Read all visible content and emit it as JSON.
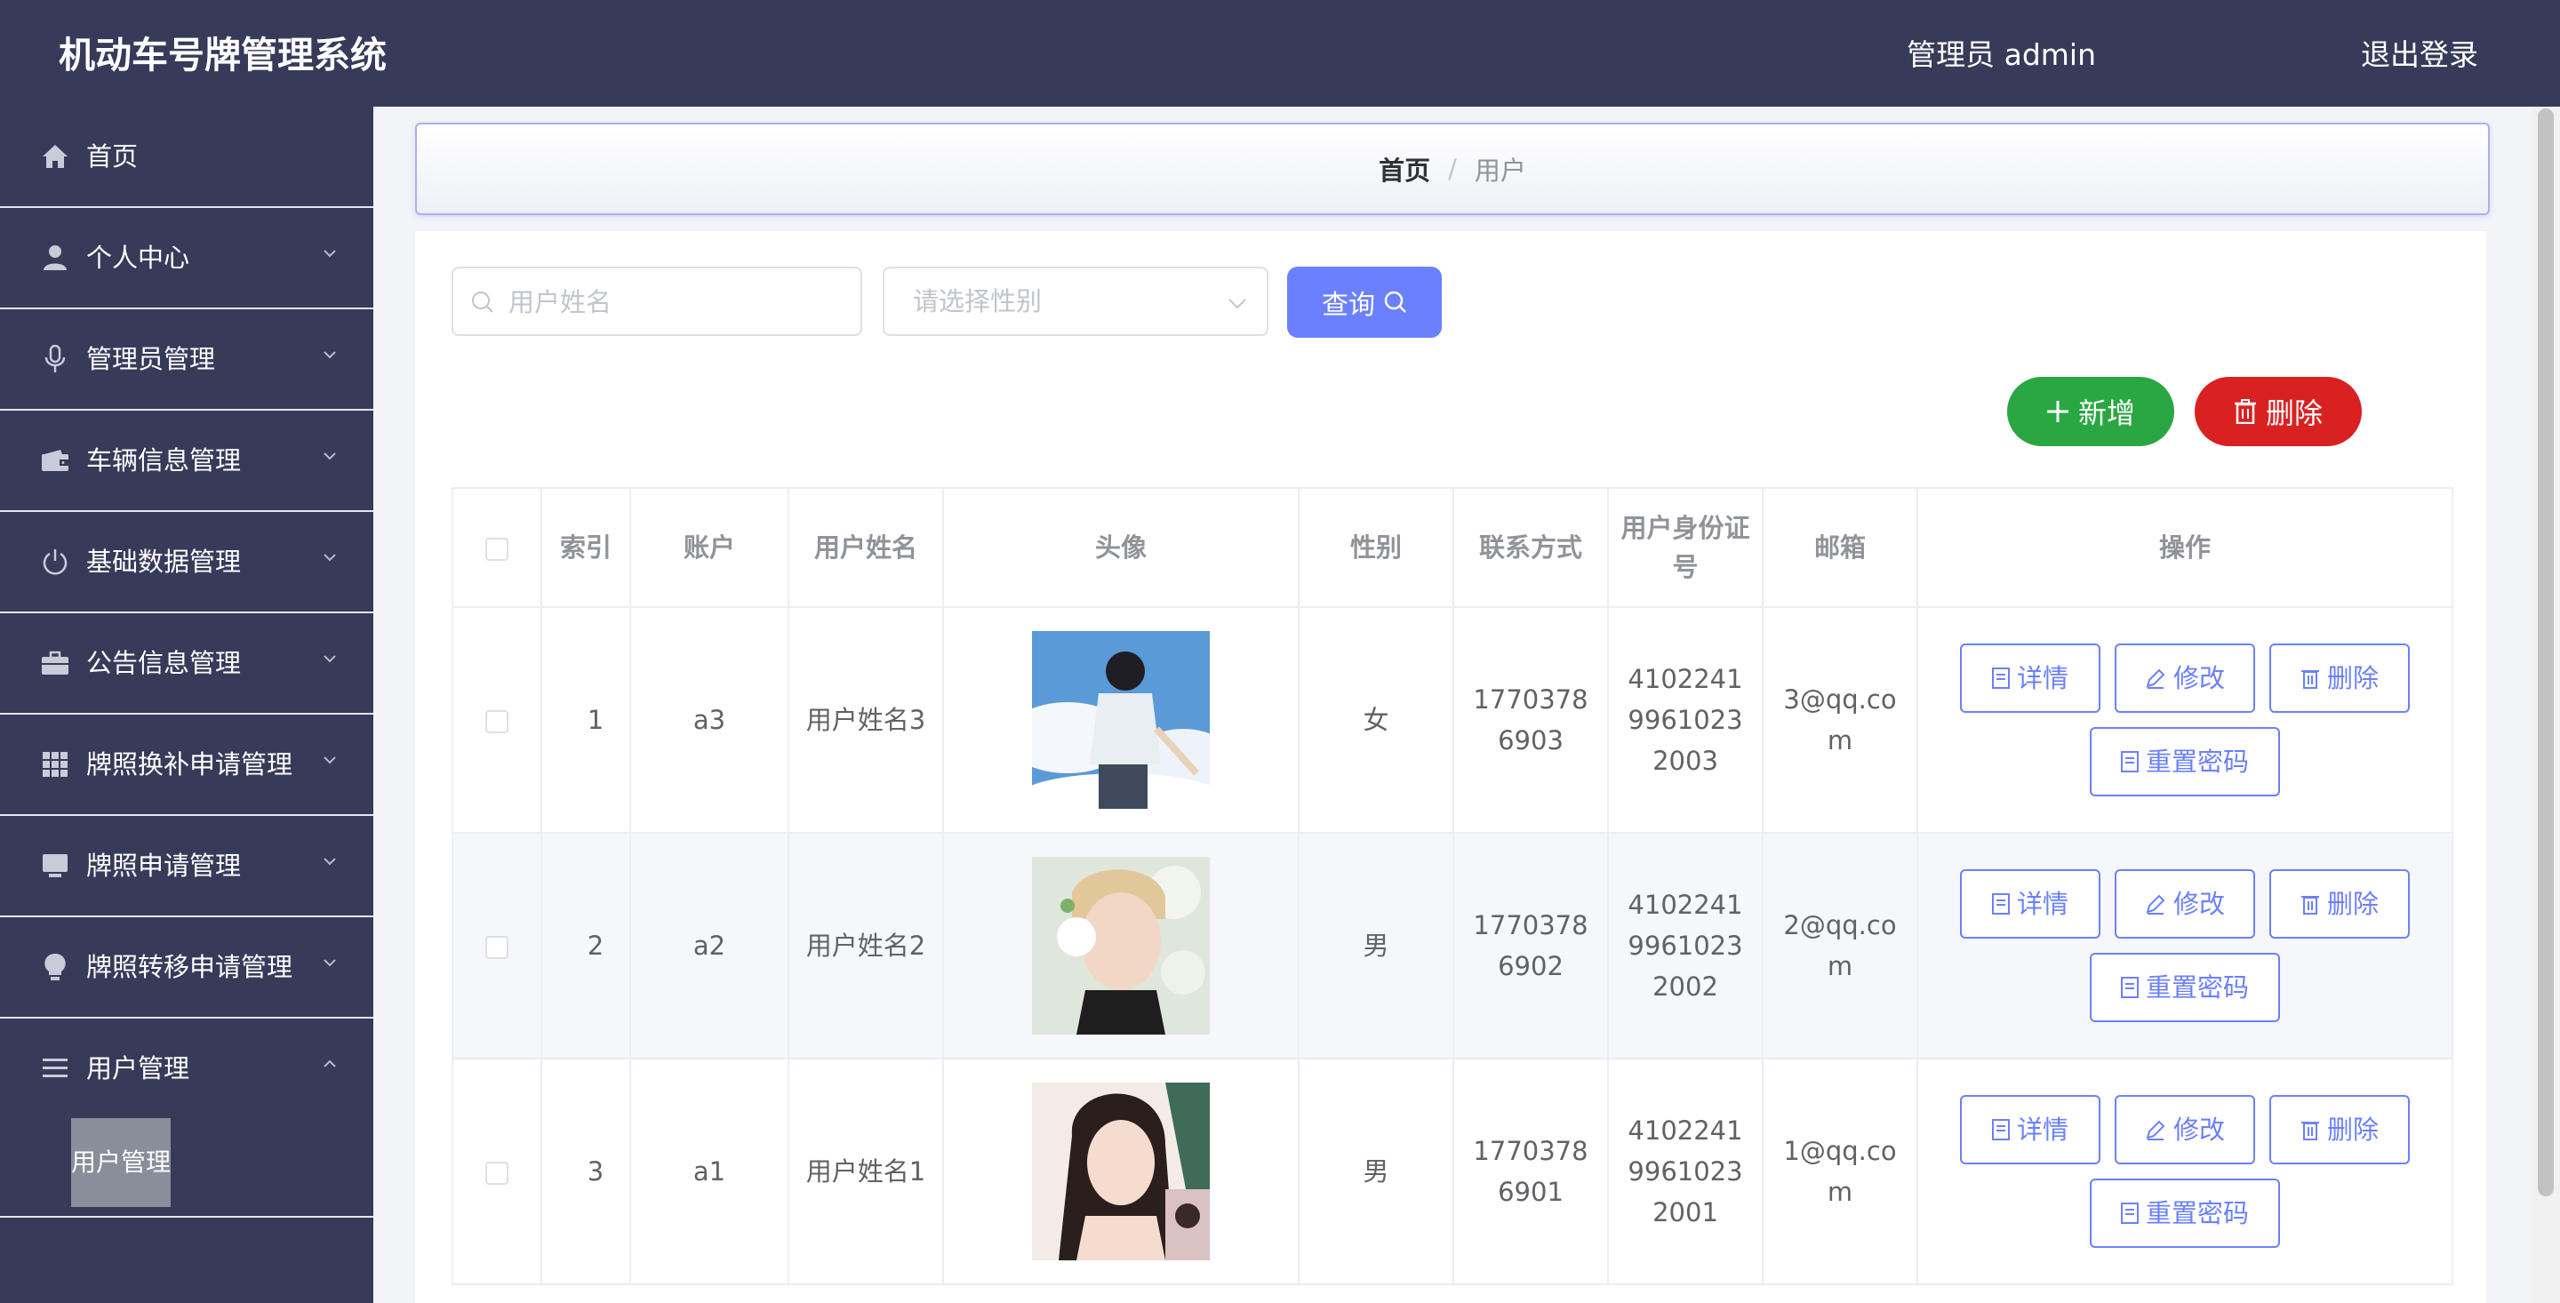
{
  "header": {
    "title": "机动车号牌管理系统",
    "user_label": "管理员 admin",
    "logout_label": "退出登录"
  },
  "sidebar": {
    "items": [
      {
        "label": "首页",
        "icon": "home-icon"
      },
      {
        "label": "个人中心",
        "icon": "user-icon"
      },
      {
        "label": "管理员管理",
        "icon": "microphone-icon"
      },
      {
        "label": "车辆信息管理",
        "icon": "wallet-icon"
      },
      {
        "label": "基础数据管理",
        "icon": "power-icon"
      },
      {
        "label": "公告信息管理",
        "icon": "briefcase-icon"
      },
      {
        "label": "牌照换补申请管理",
        "icon": "grid-icon"
      },
      {
        "label": "牌照申请管理",
        "icon": "monitor-icon"
      },
      {
        "label": "牌照转移申请管理",
        "icon": "bulb-icon"
      },
      {
        "label": "用户管理",
        "icon": "menu-icon"
      }
    ],
    "active_submenu": "用户管理"
  },
  "breadcrumb": {
    "home": "首页",
    "separator": "/",
    "current": "用户"
  },
  "search": {
    "name_placeholder": "用户姓名",
    "gender_placeholder": "请选择性别",
    "query_label": "查询"
  },
  "actions": {
    "add_label": "新增",
    "delete_label": "删除"
  },
  "table": {
    "columns": [
      "索引",
      "账户",
      "用户姓名",
      "头像",
      "性别",
      "联系方式",
      "用户身份证号",
      "邮箱",
      "操作"
    ],
    "row_actions": {
      "detail": "详情",
      "edit": "修改",
      "delete": "删除",
      "reset_password": "重置密码"
    },
    "rows": [
      {
        "index": "1",
        "account": "a3",
        "name": "用户姓名3",
        "avatar": "boy-in-clouds-avatar",
        "gender": "女",
        "phone": "17703786903",
        "id_number": "410224199610232003",
        "email": "3@qq.com"
      },
      {
        "index": "2",
        "account": "a2",
        "name": "用户姓名2",
        "avatar": "man-with-flowers-avatar",
        "gender": "男",
        "phone": "17703786902",
        "id_number": "410224199610232002",
        "email": "2@qq.com"
      },
      {
        "index": "3",
        "account": "a1",
        "name": "用户姓名1",
        "avatar": "illustrated-woman-avatar",
        "gender": "男",
        "phone": "17703786901",
        "id_number": "410224199610232001",
        "email": "1@qq.com"
      }
    ]
  },
  "colors": {
    "header_bg": "#373a59",
    "primary": "#6b80ff",
    "success": "#2aa642",
    "danger": "#d92121"
  }
}
